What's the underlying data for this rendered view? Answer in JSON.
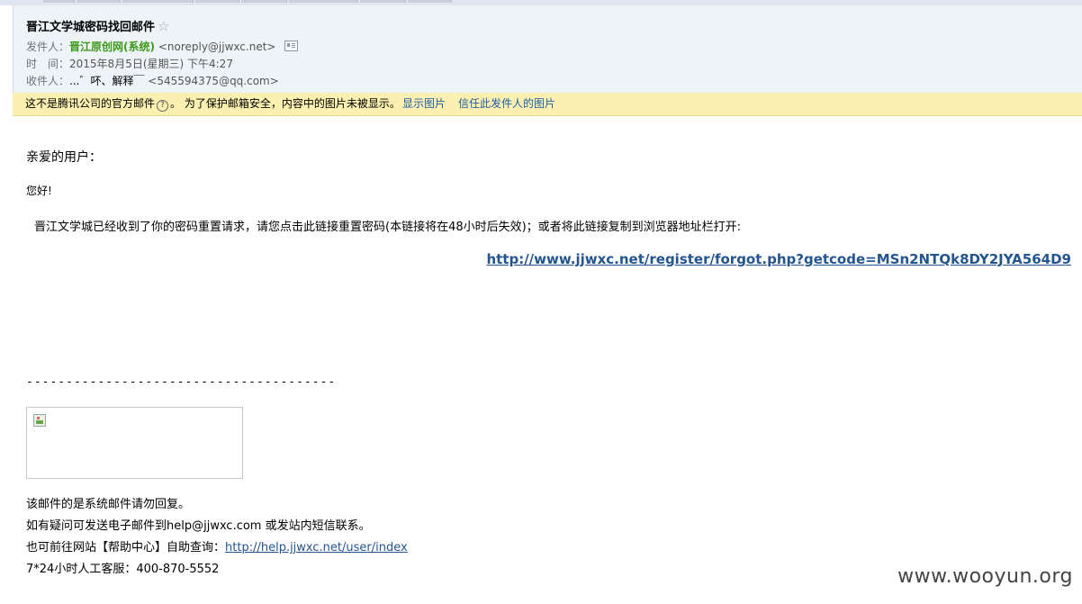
{
  "header": {
    "subject": "晋江文学城密码找回邮件",
    "star_icon": "star-icon",
    "from_label": "发件人：",
    "from_name": "晋江原创网(系统)",
    "from_addr": "<noreply@jjwxc.net>",
    "time_label": "时　间：",
    "time_value": "2015年8月5日(星期三) 下午4:27",
    "to_label": "收件人：",
    "to_name": "...゛吥、解释￣",
    "to_addr": "<545594375@qq.com>"
  },
  "warning": {
    "text_before": "这不是腾讯公司的官方邮件",
    "text_after": "。 为了保护邮箱安全，内容中的图片未被显示。",
    "show_images": "显示图片",
    "trust_sender": "信任此发件人的图片"
  },
  "body": {
    "greeting": "亲爱的用户：",
    "hello": "您好!",
    "intro": "晋江文学城已经收到了你的密码重置请求，请您点击此链接重置密码(本链接将在48小时后失效)；或者将此链接复制到浏览器地址栏打开:",
    "reset_link": "http://www.jjwxc.net/register/forgot.php?getcode=MSn2NTQk8DY2JYA564D9",
    "divider": "---------------------------------------",
    "footer1": "该邮件的是系统邮件请勿回复。",
    "footer2": "如有疑问可发送电子邮件到help@jjwxc.com 或发站内短信联系。",
    "footer3_prefix": "也可前往网站【帮助中心】自助查询：",
    "footer3_link": "http://help.jjwxc.net/user/index",
    "footer4": "7*24小时人工客服：400-870-5552"
  },
  "watermark": "www.wooyun.org",
  "colors": {
    "header_bg": "#eef3f8",
    "warning_bg": "#fbf0b0",
    "link": "#24558f",
    "sender_name": "#3c9a1b"
  }
}
